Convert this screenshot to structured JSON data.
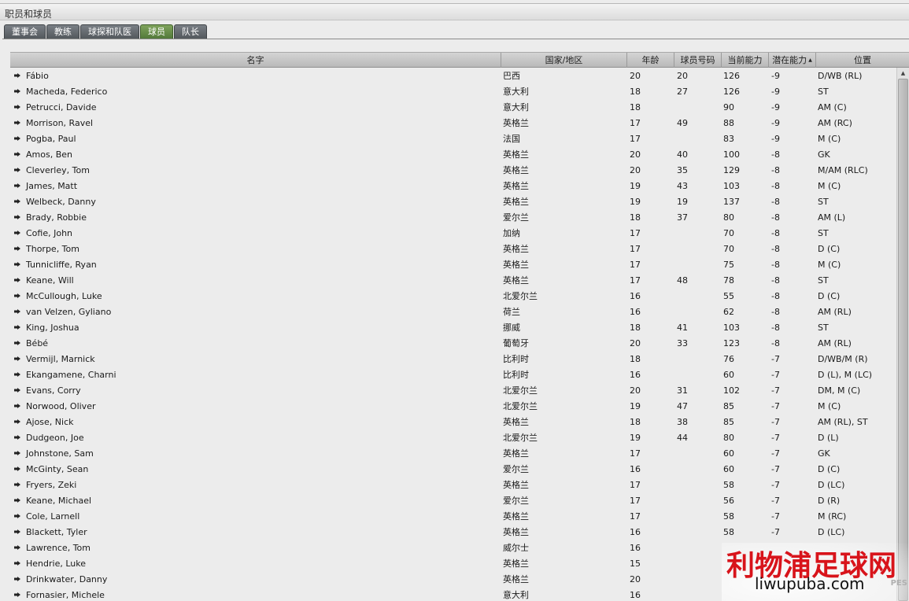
{
  "window": {
    "title": "职员和球员"
  },
  "tabs": [
    {
      "label": "董事会",
      "active": false
    },
    {
      "label": "教练",
      "active": false
    },
    {
      "label": "球探和队医",
      "active": false
    },
    {
      "label": "球员",
      "active": true
    },
    {
      "label": "队长",
      "active": false
    }
  ],
  "table": {
    "columns": [
      "名字",
      "国家/地区",
      "年龄",
      "球员号码",
      "当前能力",
      "潜在能力",
      "位置"
    ],
    "sorted_column": "潜在能力",
    "rows": [
      [
        "Fábio",
        "巴西",
        "20",
        "20",
        "126",
        "-9",
        "D/WB (RL)"
      ],
      [
        "Macheda, Federico",
        "意大利",
        "18",
        "27",
        "126",
        "-9",
        "ST"
      ],
      [
        "Petrucci, Davide",
        "意大利",
        "18",
        "",
        "90",
        "-9",
        "AM (C)"
      ],
      [
        "Morrison, Ravel",
        "英格兰",
        "17",
        "49",
        "88",
        "-9",
        "AM (RC)"
      ],
      [
        "Pogba, Paul",
        "法国",
        "17",
        "",
        "83",
        "-9",
        "M (C)"
      ],
      [
        "Amos, Ben",
        "英格兰",
        "20",
        "40",
        "100",
        "-8",
        "GK"
      ],
      [
        "Cleverley, Tom",
        "英格兰",
        "20",
        "35",
        "129",
        "-8",
        "M/AM (RLC)"
      ],
      [
        "James, Matt",
        "英格兰",
        "19",
        "43",
        "103",
        "-8",
        "M (C)"
      ],
      [
        "Welbeck, Danny",
        "英格兰",
        "19",
        "19",
        "137",
        "-8",
        "ST"
      ],
      [
        "Brady, Robbie",
        "爱尔兰",
        "18",
        "37",
        "80",
        "-8",
        "AM (L)"
      ],
      [
        "Cofie, John",
        "加纳",
        "17",
        "",
        "70",
        "-8",
        "ST"
      ],
      [
        "Thorpe, Tom",
        "英格兰",
        "17",
        "",
        "70",
        "-8",
        "D (C)"
      ],
      [
        "Tunnicliffe, Ryan",
        "英格兰",
        "17",
        "",
        "75",
        "-8",
        "M (C)"
      ],
      [
        "Keane, Will",
        "英格兰",
        "17",
        "48",
        "78",
        "-8",
        "ST"
      ],
      [
        "McCullough, Luke",
        "北爱尔兰",
        "16",
        "",
        "55",
        "-8",
        "D (C)"
      ],
      [
        "van Velzen, Gyliano",
        "荷兰",
        "16",
        "",
        "62",
        "-8",
        "AM (RL)"
      ],
      [
        "King, Joshua",
        "挪威",
        "18",
        "41",
        "103",
        "-8",
        "ST"
      ],
      [
        "Bébé",
        "葡萄牙",
        "20",
        "33",
        "123",
        "-8",
        "AM (RL)"
      ],
      [
        "Vermijl, Marnick",
        "比利时",
        "18",
        "",
        "76",
        "-7",
        "D/WB/M (R)"
      ],
      [
        "Ekangamene, Charni",
        "比利时",
        "16",
        "",
        "60",
        "-7",
        "D (L), M (LC)"
      ],
      [
        "Evans, Corry",
        "北爱尔兰",
        "20",
        "31",
        "102",
        "-7",
        "DM, M (C)"
      ],
      [
        "Norwood, Oliver",
        "北爱尔兰",
        "19",
        "47",
        "85",
        "-7",
        "M (C)"
      ],
      [
        "Ajose, Nick",
        "英格兰",
        "18",
        "38",
        "85",
        "-7",
        "AM (RL), ST"
      ],
      [
        "Dudgeon, Joe",
        "北爱尔兰",
        "19",
        "44",
        "80",
        "-7",
        "D (L)"
      ],
      [
        "Johnstone, Sam",
        "英格兰",
        "17",
        "",
        "60",
        "-7",
        "GK"
      ],
      [
        "McGinty, Sean",
        "爱尔兰",
        "16",
        "",
        "60",
        "-7",
        "D (C)"
      ],
      [
        "Fryers, Zeki",
        "英格兰",
        "17",
        "",
        "58",
        "-7",
        "D (LC)"
      ],
      [
        "Keane, Michael",
        "爱尔兰",
        "17",
        "",
        "56",
        "-7",
        "D (R)"
      ],
      [
        "Cole, Larnell",
        "英格兰",
        "17",
        "",
        "58",
        "-7",
        "M (RC)"
      ],
      [
        "Blackett, Tyler",
        "英格兰",
        "16",
        "",
        "58",
        "-7",
        "D (LC)"
      ],
      [
        "Lawrence, Tom",
        "威尔士",
        "16",
        "",
        "",
        "",
        ""
      ],
      [
        "Hendrie, Luke",
        "英格兰",
        "15",
        "",
        "",
        "",
        ""
      ],
      [
        "Drinkwater, Danny",
        "英格兰",
        "20",
        "",
        "",
        "",
        ""
      ],
      [
        "Fornasier, Michele",
        "意大利",
        "16",
        "",
        "",
        "",
        ""
      ]
    ]
  },
  "watermark": {
    "cn": "利物浦足球网",
    "url": "liwupuba.com",
    "mark": "PES"
  },
  "colors": {
    "tab_active": "#5f8a44",
    "tab_inactive": "#62676c",
    "header": "#c4c4c4"
  }
}
